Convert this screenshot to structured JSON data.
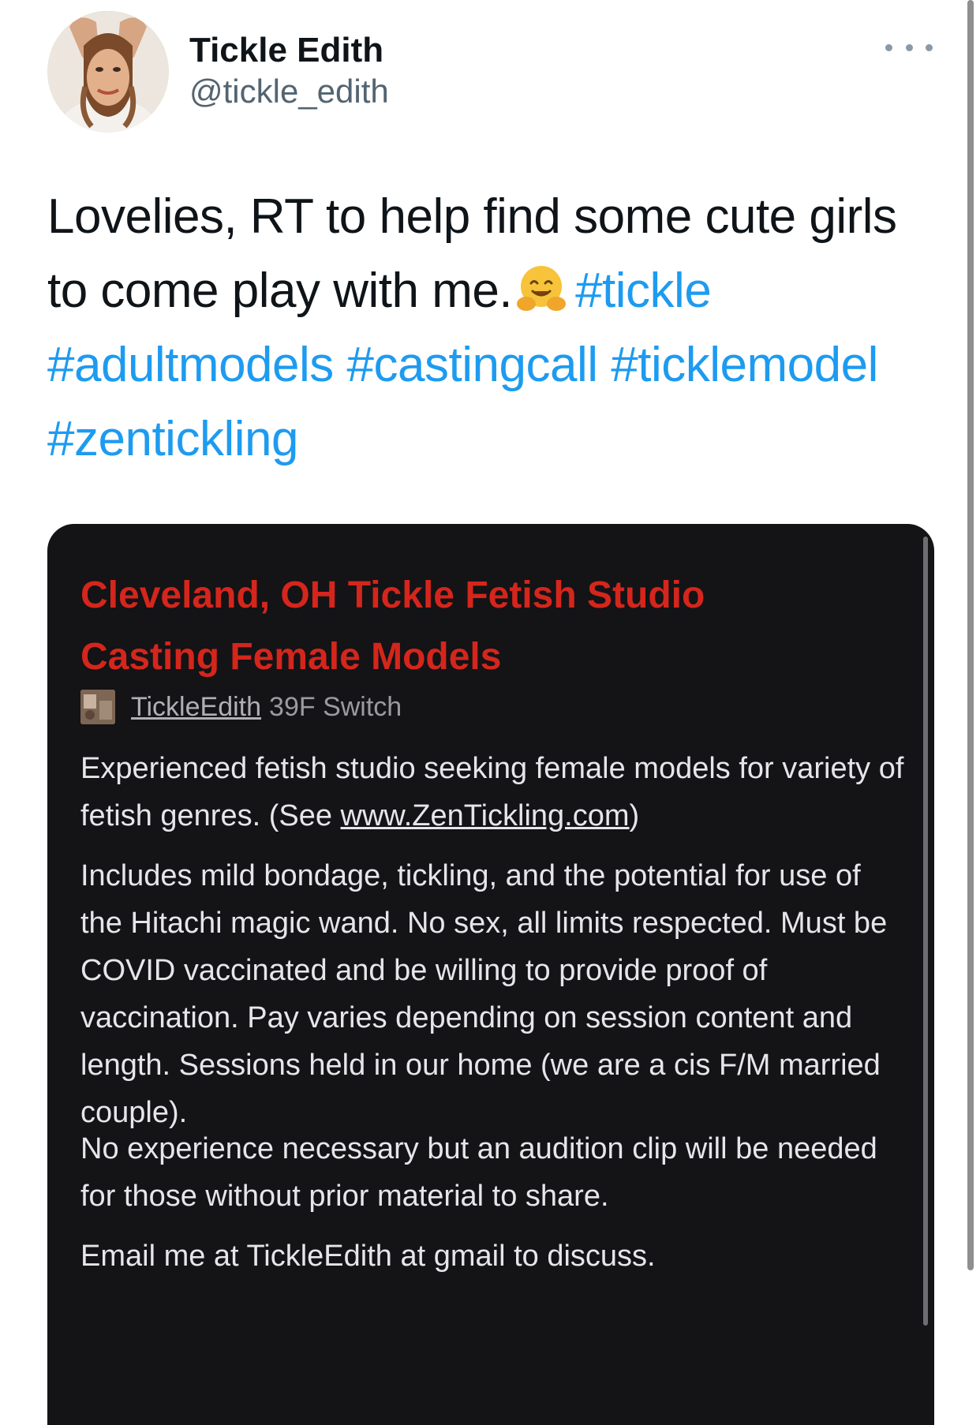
{
  "tweet": {
    "display_name": "Tickle Edith",
    "handle": "@tickle_edith",
    "text_before_emoji": "Lovelies, RT to help find some cute girls to come play with me.",
    "emoji": "hugging-face",
    "hashtags": [
      "#tickle",
      "#adultmodels",
      "#castingcall",
      "#ticklemodel",
      "#zentickling"
    ]
  },
  "card": {
    "title_line1": "Cleveland, OH Tickle Fetish Studio",
    "title_line2": "Casting Female Models",
    "username": "TickleEdith",
    "user_info": "39F Switch",
    "paragraph1_before": "Experienced fetish studio seeking female models for variety of fetish genres. (See ",
    "paragraph1_link": "www.ZenTickling.com",
    "paragraph1_after": ")",
    "paragraph2": "Includes mild bondage, tickling, and the potential for use of the Hitachi magic wand. No sex, all limits respected. Must be COVID vaccinated and be willing to provide proof of vaccination. Pay varies depending on session content and length. Sessions held in our home (we are a cis F/M married couple).",
    "paragraph3": "No experience necessary but an audition clip will be needed for those without prior material to share.",
    "paragraph4": "Email me at TickleEdith at gmail to discuss."
  },
  "colors": {
    "hashtag": "#1d9bf0",
    "card_background": "#141316",
    "card_title": "#d4261c"
  }
}
